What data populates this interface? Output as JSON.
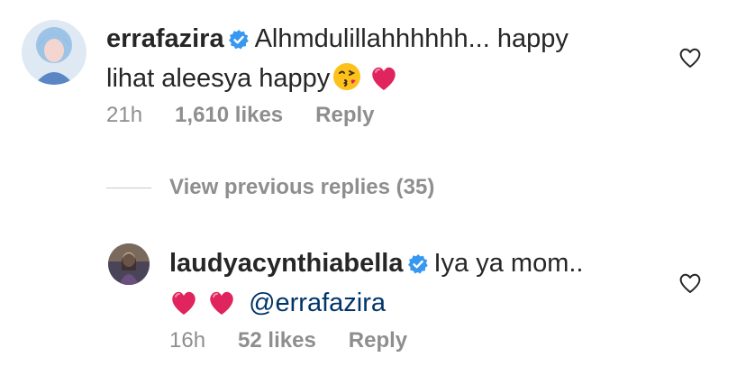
{
  "comments": [
    {
      "username": "errafazira",
      "text_line1": "Alhmdulillahhhhhh... happy",
      "text_line2": "lihat aleesya happy",
      "time": "21h",
      "likes": "1,610 likes",
      "reply": "Reply"
    },
    {
      "username": "laudyacynthiabella",
      "text_line1": "Iya ya mom..",
      "mention": "@errafazira",
      "time": "16h",
      "likes": "52 likes",
      "reply": "Reply"
    }
  ],
  "view_replies": "View previous replies (35)",
  "icons": {
    "verified": "verified-badge-icon",
    "like": "heart-outline-icon",
    "emoji_kiss": "face-blowing-kiss-emoji",
    "emoji_heart": "red-heart-emoji"
  },
  "colors": {
    "verified": "#3897f0",
    "heart_emoji": "#e0245e",
    "mention": "#003569",
    "meta": "#8e8e8e"
  }
}
